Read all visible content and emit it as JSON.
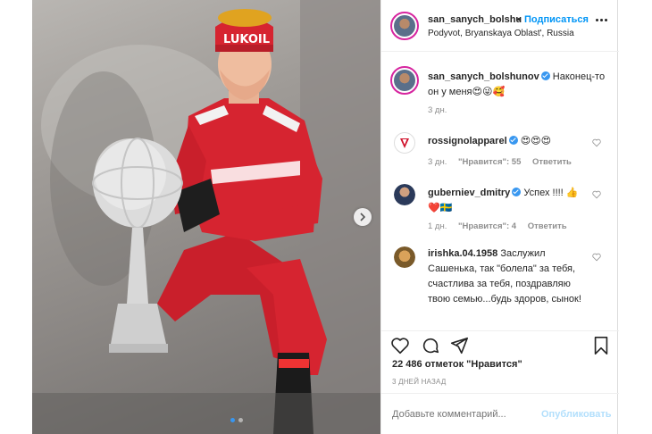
{
  "header": {
    "username": "san_sanych_bolshu",
    "separator": "•",
    "follow_label": "Подписаться",
    "location": "Podyvot, Bryanskaya Oblast', Russia"
  },
  "caption": {
    "username": "san_sanych_bolshunov",
    "text": "Наконец-то он у меня😍😜🥰",
    "age": "3 дн."
  },
  "comments": [
    {
      "username": "rossignolapparel",
      "verified": true,
      "text": "😍😍😍",
      "age": "3 дн.",
      "likes": "\"Нравится\": 55",
      "reply": "Ответить"
    },
    {
      "username": "guberniev_dmitry",
      "verified": true,
      "text": "Успех !!!! 👍❤️🇸🇪",
      "age": "1 дн.",
      "likes": "\"Нравится\": 4",
      "reply": "Ответить"
    },
    {
      "username": "irishka.04.1958",
      "verified": false,
      "text": "Заслужил Сашенька, так \"болела\" за тебя, счастлива за тебя, поздравляю твою семью...будь здоров, сынок!"
    }
  ],
  "likes_summary": "22 486 отметок \"Нравится\"",
  "post_date": "3 ДНЕЙ НАЗАД",
  "add_comment": {
    "placeholder": "Добавьте комментарий...",
    "publish_label": "Опубликовать"
  },
  "photo": {
    "carousel_current": 1,
    "carousel_total": 2,
    "cap_text": "LUKOIL"
  },
  "colors": {
    "follow_blue": "#0095f6",
    "verified_blue": "#3897f0",
    "publish_disabled": "#b2dffc",
    "suit_red": "#d62430"
  },
  "icons": [
    "heart-icon",
    "comment-icon",
    "share-icon",
    "bookmark-icon",
    "more-icon",
    "chevron-right-icon"
  ]
}
